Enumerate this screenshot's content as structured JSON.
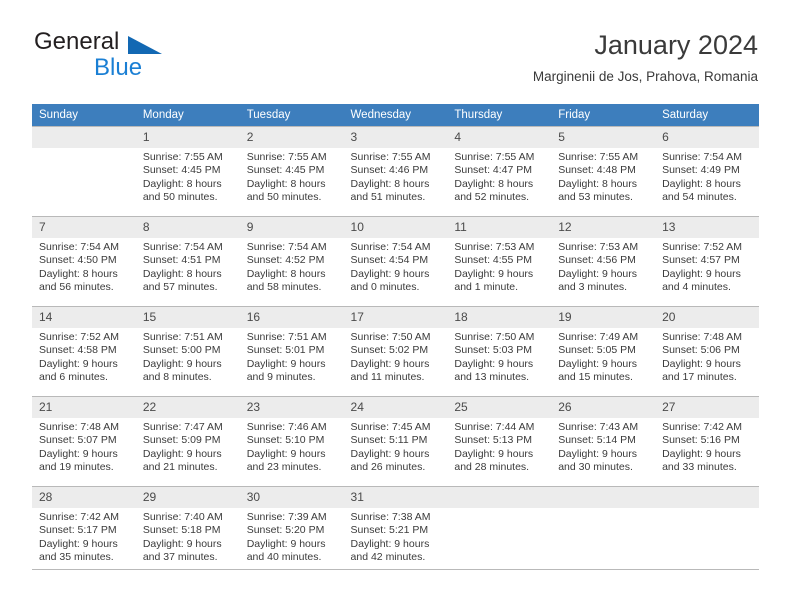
{
  "logo": {
    "word_one": "General",
    "word_two": "Blue",
    "triangle_icon": "triangle-icon",
    "color_dark": "#231f20",
    "color_blue": "#1a7fd4"
  },
  "header": {
    "title": "January 2024",
    "subtitle": "Marginenii de Jos, Prahova, Romania"
  },
  "theme": {
    "header_bg": "#3d7ebd",
    "daynum_bg": "#ececec",
    "grid_line": "#b9b9b9"
  },
  "calendar": {
    "weekday_headers": [
      "Sunday",
      "Monday",
      "Tuesday",
      "Wednesday",
      "Thursday",
      "Friday",
      "Saturday"
    ],
    "weeks": [
      [
        {
          "day": "",
          "lines": []
        },
        {
          "day": "1",
          "lines": [
            "Sunrise: 7:55 AM",
            "Sunset: 4:45 PM",
            "Daylight: 8 hours",
            "and 50 minutes."
          ]
        },
        {
          "day": "2",
          "lines": [
            "Sunrise: 7:55 AM",
            "Sunset: 4:45 PM",
            "Daylight: 8 hours",
            "and 50 minutes."
          ]
        },
        {
          "day": "3",
          "lines": [
            "Sunrise: 7:55 AM",
            "Sunset: 4:46 PM",
            "Daylight: 8 hours",
            "and 51 minutes."
          ]
        },
        {
          "day": "4",
          "lines": [
            "Sunrise: 7:55 AM",
            "Sunset: 4:47 PM",
            "Daylight: 8 hours",
            "and 52 minutes."
          ]
        },
        {
          "day": "5",
          "lines": [
            "Sunrise: 7:55 AM",
            "Sunset: 4:48 PM",
            "Daylight: 8 hours",
            "and 53 minutes."
          ]
        },
        {
          "day": "6",
          "lines": [
            "Sunrise: 7:54 AM",
            "Sunset: 4:49 PM",
            "Daylight: 8 hours",
            "and 54 minutes."
          ]
        }
      ],
      [
        {
          "day": "7",
          "lines": [
            "Sunrise: 7:54 AM",
            "Sunset: 4:50 PM",
            "Daylight: 8 hours",
            "and 56 minutes."
          ]
        },
        {
          "day": "8",
          "lines": [
            "Sunrise: 7:54 AM",
            "Sunset: 4:51 PM",
            "Daylight: 8 hours",
            "and 57 minutes."
          ]
        },
        {
          "day": "9",
          "lines": [
            "Sunrise: 7:54 AM",
            "Sunset: 4:52 PM",
            "Daylight: 8 hours",
            "and 58 minutes."
          ]
        },
        {
          "day": "10",
          "lines": [
            "Sunrise: 7:54 AM",
            "Sunset: 4:54 PM",
            "Daylight: 9 hours",
            "and 0 minutes."
          ]
        },
        {
          "day": "11",
          "lines": [
            "Sunrise: 7:53 AM",
            "Sunset: 4:55 PM",
            "Daylight: 9 hours",
            "and 1 minute."
          ]
        },
        {
          "day": "12",
          "lines": [
            "Sunrise: 7:53 AM",
            "Sunset: 4:56 PM",
            "Daylight: 9 hours",
            "and 3 minutes."
          ]
        },
        {
          "day": "13",
          "lines": [
            "Sunrise: 7:52 AM",
            "Sunset: 4:57 PM",
            "Daylight: 9 hours",
            "and 4 minutes."
          ]
        }
      ],
      [
        {
          "day": "14",
          "lines": [
            "Sunrise: 7:52 AM",
            "Sunset: 4:58 PM",
            "Daylight: 9 hours",
            "and 6 minutes."
          ]
        },
        {
          "day": "15",
          "lines": [
            "Sunrise: 7:51 AM",
            "Sunset: 5:00 PM",
            "Daylight: 9 hours",
            "and 8 minutes."
          ]
        },
        {
          "day": "16",
          "lines": [
            "Sunrise: 7:51 AM",
            "Sunset: 5:01 PM",
            "Daylight: 9 hours",
            "and 9 minutes."
          ]
        },
        {
          "day": "17",
          "lines": [
            "Sunrise: 7:50 AM",
            "Sunset: 5:02 PM",
            "Daylight: 9 hours",
            "and 11 minutes."
          ]
        },
        {
          "day": "18",
          "lines": [
            "Sunrise: 7:50 AM",
            "Sunset: 5:03 PM",
            "Daylight: 9 hours",
            "and 13 minutes."
          ]
        },
        {
          "day": "19",
          "lines": [
            "Sunrise: 7:49 AM",
            "Sunset: 5:05 PM",
            "Daylight: 9 hours",
            "and 15 minutes."
          ]
        },
        {
          "day": "20",
          "lines": [
            "Sunrise: 7:48 AM",
            "Sunset: 5:06 PM",
            "Daylight: 9 hours",
            "and 17 minutes."
          ]
        }
      ],
      [
        {
          "day": "21",
          "lines": [
            "Sunrise: 7:48 AM",
            "Sunset: 5:07 PM",
            "Daylight: 9 hours",
            "and 19 minutes."
          ]
        },
        {
          "day": "22",
          "lines": [
            "Sunrise: 7:47 AM",
            "Sunset: 5:09 PM",
            "Daylight: 9 hours",
            "and 21 minutes."
          ]
        },
        {
          "day": "23",
          "lines": [
            "Sunrise: 7:46 AM",
            "Sunset: 5:10 PM",
            "Daylight: 9 hours",
            "and 23 minutes."
          ]
        },
        {
          "day": "24",
          "lines": [
            "Sunrise: 7:45 AM",
            "Sunset: 5:11 PM",
            "Daylight: 9 hours",
            "and 26 minutes."
          ]
        },
        {
          "day": "25",
          "lines": [
            "Sunrise: 7:44 AM",
            "Sunset: 5:13 PM",
            "Daylight: 9 hours",
            "and 28 minutes."
          ]
        },
        {
          "day": "26",
          "lines": [
            "Sunrise: 7:43 AM",
            "Sunset: 5:14 PM",
            "Daylight: 9 hours",
            "and 30 minutes."
          ]
        },
        {
          "day": "27",
          "lines": [
            "Sunrise: 7:42 AM",
            "Sunset: 5:16 PM",
            "Daylight: 9 hours",
            "and 33 minutes."
          ]
        }
      ],
      [
        {
          "day": "28",
          "lines": [
            "Sunrise: 7:42 AM",
            "Sunset: 5:17 PM",
            "Daylight: 9 hours",
            "and 35 minutes."
          ]
        },
        {
          "day": "29",
          "lines": [
            "Sunrise: 7:40 AM",
            "Sunset: 5:18 PM",
            "Daylight: 9 hours",
            "and 37 minutes."
          ]
        },
        {
          "day": "30",
          "lines": [
            "Sunrise: 7:39 AM",
            "Sunset: 5:20 PM",
            "Daylight: 9 hours",
            "and 40 minutes."
          ]
        },
        {
          "day": "31",
          "lines": [
            "Sunrise: 7:38 AM",
            "Sunset: 5:21 PM",
            "Daylight: 9 hours",
            "and 42 minutes."
          ]
        },
        {
          "day": "",
          "lines": []
        },
        {
          "day": "",
          "lines": []
        },
        {
          "day": "",
          "lines": []
        }
      ]
    ]
  }
}
